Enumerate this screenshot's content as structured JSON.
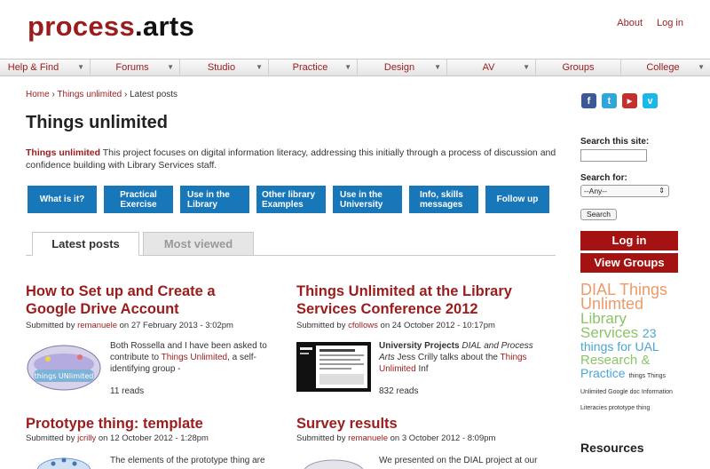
{
  "header": {
    "site_part1": "process",
    "site_part2": ".",
    "site_part3": "arts",
    "about": "About",
    "login": "Log in"
  },
  "nav": [
    {
      "label": "Help & Find"
    },
    {
      "label": "Forums"
    },
    {
      "label": "Studio"
    },
    {
      "label": "Practice"
    },
    {
      "label": "Design"
    },
    {
      "label": "AV"
    },
    {
      "label": "Groups"
    },
    {
      "label": "College"
    }
  ],
  "breadcrumb": {
    "home": "Home",
    "sep1": " › ",
    "section": "Things unlimited",
    "sep2": " › ",
    "current": "Latest posts"
  },
  "page": {
    "title": "Things unlimited",
    "intro_bold": "Things unlimited",
    "intro_text": " This project focuses on digital information literacy, addressing this initially through a process of discussion and confidence building with Library Services staff."
  },
  "buttons": {
    "b1": "What is it?",
    "b2a": "Practical",
    "b2b": "Exercise",
    "b3a": "Use in the",
    "b3b": "Library",
    "b4a": "Other library",
    "b4b": "Examples",
    "b5a": "Use in the",
    "b5b": "University",
    "b6a": "Info, skills",
    "b6b": "messages",
    "b7": "Follow up"
  },
  "tabs": {
    "latest": "Latest posts",
    "most": "Most viewed"
  },
  "posts": {
    "p1": {
      "title1": "How to Set up and Create a",
      "title2": "Google Drive Account",
      "submitted": "Submitted by ",
      "user": "remanuele",
      "date": " on 27 February 2013 - 3:02pm",
      "body1": "Both Rossella and I have been asked to",
      "body2a": "contribute to ",
      "body2b": "Things Unlimited",
      "body2c": ", a self-",
      "body3": "identifying group -",
      "reads": "11 reads"
    },
    "p2": {
      "title1": "Things Unlimited at the Library",
      "title2": "Services Conference 2012",
      "submitted": "Submitted by ",
      "user": "cfollows",
      "date": " on 24 October 2012 - 10:17pm",
      "body1a": "University Projects",
      "body1b": " DIAL and Process",
      "body2a": "Arts",
      "body2b": " Jess Crilly talks about the ",
      "body2c": "Things",
      "body3a": "Unlimited",
      "body3b": " Inf",
      "reads": "832 reads"
    },
    "p3": {
      "title": "Prototype thing: template",
      "submitted": "Submitted by ",
      "user": "jcrilly",
      "date": " on 12 October 2012 - 1:28pm",
      "body1": "The elements of the prototype thing are"
    },
    "p4": {
      "title": "Survey results",
      "submitted": "Submitted by ",
      "user": "remanuele",
      "date": " on 3 October 2012 - 8:09pm",
      "body1": "We presented on the DIAL project at our"
    }
  },
  "sidebar": {
    "search_site": "Search this site:",
    "search_for": "Search for:",
    "select_value": "--Any--",
    "search_btn": "Search",
    "login_btn": "Log in",
    "groups_btn": "View Groups",
    "tags": {
      "t1": "DIAL ",
      "t2": "Things ",
      "t3": "Unlimted ",
      "t4": "Library ",
      "t5": "Services ",
      "t6": "23 things for UAL ",
      "t7": "Research & ",
      "t8": "Practice ",
      "t9": "things Things Unlimited Google doc Information Literacies prototype thing"
    },
    "resources": "Resources"
  },
  "colors": {
    "brand_red": "#9b1c1c",
    "button_blue": "#1877b8",
    "sidebar_red": "#a41212"
  }
}
